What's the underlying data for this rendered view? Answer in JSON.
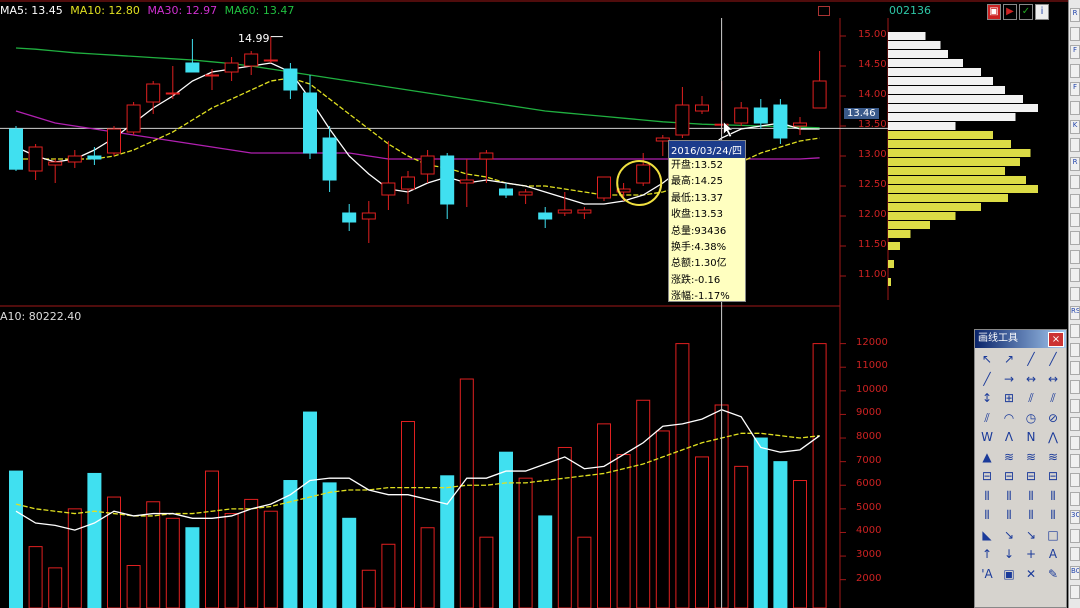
{
  "ma_legend": {
    "ma5": {
      "label": "MA5: 13.45",
      "color": "#ffffff"
    },
    "ma10": {
      "label": "MA10: 12.80",
      "color": "#e0e020"
    },
    "ma30": {
      "label": "MA30: 12.97",
      "color": "#c020c0"
    },
    "ma60": {
      "label": "MA60: 13.47",
      "color": "#20c040"
    }
  },
  "volume_legend": "A10: 80222.40",
  "stock_code": "002136",
  "current_price_tag": "13.46",
  "peak_label": "14.99",
  "price_axis_labels": [
    "15.00",
    "14.50",
    "14.00",
    "13.50",
    "13.00",
    "12.50",
    "12.00",
    "11.50",
    "11.00"
  ],
  "volume_axis_labels": [
    "12000",
    "11000",
    "10000",
    "9000",
    "8000",
    "7000",
    "6000",
    "5000",
    "4000",
    "3000",
    "2000"
  ],
  "tooltip": {
    "date": "2016/03/24/四",
    "rows": [
      "开盘:13.52",
      "最高:14.25",
      "最低:13.37",
      "收盘:13.53",
      "总量:93436",
      "换手:4.38%",
      "总额:1.30亿",
      "涨跌:-0.16",
      "涨幅:-1.17%"
    ]
  },
  "toolbox": {
    "title": "画线工具",
    "close": "×",
    "tools": [
      "↖",
      "↗",
      "╱",
      "╱",
      "╱",
      "→",
      "↔",
      "↔",
      "↕",
      "⊞",
      "⫽",
      "⫽",
      "⫽",
      "◠",
      "◷",
      "⊘",
      "W",
      "Λ",
      "Ν",
      "⋀",
      "▲",
      "≋",
      "≋",
      "≋",
      "⊟",
      "⊟",
      "⊟",
      "⊟",
      "⦀",
      "⦀",
      "⦀",
      "⦀",
      "⦀",
      "⦀",
      "⦀",
      "⦀",
      "◣",
      "↘",
      "↘",
      "□",
      "↑",
      "↓",
      "+",
      "A",
      "'A",
      "▣",
      "✕",
      "✎"
    ]
  },
  "right_strip_labels": [
    "R",
    "",
    "F",
    "",
    "F",
    "",
    "K",
    "",
    "R",
    "",
    "",
    "",
    "",
    "",
    "",
    "",
    "RS",
    "",
    "",
    "",
    "",
    "",
    "",
    "",
    "",
    "",
    "",
    "3C",
    "",
    "",
    "B0",
    ""
  ],
  "chart_data": {
    "type": "candlestick",
    "price_axis": {
      "ylim": [
        10.6,
        15.3
      ],
      "ticks": [
        15.0,
        14.5,
        14.0,
        13.5,
        13.0,
        12.5,
        12.0,
        11.5,
        11.0
      ]
    },
    "volume_axis": {
      "ylim": [
        800,
        13000
      ],
      "ticks": [
        12000,
        11000,
        10000,
        9000,
        8000,
        7000,
        6000,
        5000,
        4000,
        3000,
        2000
      ]
    },
    "up_color": "#e02020",
    "down_color": "#40e0f0",
    "candles": [
      {
        "o": 13.45,
        "h": 13.5,
        "l": 12.75,
        "c": 12.78
      },
      {
        "o": 12.75,
        "h": 13.2,
        "l": 12.6,
        "c": 13.15
      },
      {
        "o": 12.85,
        "h": 12.95,
        "l": 12.55,
        "c": 12.9
      },
      {
        "o": 12.9,
        "h": 13.1,
        "l": 12.8,
        "c": 13.0
      },
      {
        "o": 13.0,
        "h": 13.15,
        "l": 12.85,
        "c": 12.95
      },
      {
        "o": 13.05,
        "h": 13.5,
        "l": 13.0,
        "c": 13.45
      },
      {
        "o": 13.4,
        "h": 13.9,
        "l": 13.35,
        "c": 13.85
      },
      {
        "o": 13.9,
        "h": 14.25,
        "l": 13.7,
        "c": 14.2
      },
      {
        "o": 14.05,
        "h": 14.5,
        "l": 13.95,
        "c": 14.05
      },
      {
        "o": 14.55,
        "h": 14.95,
        "l": 14.4,
        "c": 14.4
      },
      {
        "o": 14.35,
        "h": 14.45,
        "l": 14.1,
        "c": 14.35
      },
      {
        "o": 14.4,
        "h": 14.65,
        "l": 14.25,
        "c": 14.55
      },
      {
        "o": 14.5,
        "h": 14.75,
        "l": 14.35,
        "c": 14.7
      },
      {
        "o": 14.6,
        "h": 14.99,
        "l": 14.55,
        "c": 14.6
      },
      {
        "o": 14.45,
        "h": 14.55,
        "l": 13.95,
        "c": 14.1
      },
      {
        "o": 14.05,
        "h": 14.35,
        "l": 12.95,
        "c": 13.05
      },
      {
        "o": 13.3,
        "h": 13.5,
        "l": 12.4,
        "c": 12.6
      },
      {
        "o": 12.05,
        "h": 12.2,
        "l": 11.75,
        "c": 11.9
      },
      {
        "o": 11.95,
        "h": 12.25,
        "l": 11.55,
        "c": 12.05
      },
      {
        "o": 12.35,
        "h": 13.25,
        "l": 12.1,
        "c": 12.55
      },
      {
        "o": 12.45,
        "h": 12.75,
        "l": 12.2,
        "c": 12.65
      },
      {
        "o": 12.7,
        "h": 13.1,
        "l": 12.55,
        "c": 13.0
      },
      {
        "o": 13.0,
        "h": 13.05,
        "l": 11.95,
        "c": 12.2
      },
      {
        "o": 12.55,
        "h": 12.95,
        "l": 12.15,
        "c": 12.6
      },
      {
        "o": 12.95,
        "h": 13.1,
        "l": 12.55,
        "c": 13.05
      },
      {
        "o": 12.45,
        "h": 12.55,
        "l": 12.3,
        "c": 12.35
      },
      {
        "o": 12.35,
        "h": 12.45,
        "l": 12.2,
        "c": 12.4
      },
      {
        "o": 12.05,
        "h": 12.15,
        "l": 11.8,
        "c": 11.95
      },
      {
        "o": 12.05,
        "h": 12.4,
        "l": 12.0,
        "c": 12.1
      },
      {
        "o": 12.05,
        "h": 12.15,
        "l": 11.95,
        "c": 12.1
      },
      {
        "o": 12.3,
        "h": 12.65,
        "l": 12.25,
        "c": 12.65
      },
      {
        "o": 12.4,
        "h": 12.55,
        "l": 12.25,
        "c": 12.45
      },
      {
        "o": 12.55,
        "h": 13.05,
        "l": 12.5,
        "c": 12.85
      },
      {
        "o": 13.25,
        "h": 13.35,
        "l": 13.0,
        "c": 13.3
      },
      {
        "o": 13.35,
        "h": 14.15,
        "l": 13.3,
        "c": 13.85
      },
      {
        "o": 13.75,
        "h": 14.0,
        "l": 13.7,
        "c": 13.85
      },
      {
        "o": 13.52,
        "h": 14.25,
        "l": 13.37,
        "c": 13.53
      },
      {
        "o": 13.55,
        "h": 13.9,
        "l": 13.5,
        "c": 13.8
      },
      {
        "o": 13.8,
        "h": 13.95,
        "l": 13.45,
        "c": 13.55
      },
      {
        "o": 13.85,
        "h": 13.95,
        "l": 13.2,
        "c": 13.3
      },
      {
        "o": 13.5,
        "h": 13.65,
        "l": 13.35,
        "c": 13.55
      },
      {
        "o": 13.8,
        "h": 14.75,
        "l": 13.85,
        "c": 14.25
      }
    ],
    "volumes": [
      6600,
      3400,
      2500,
      5000,
      6500,
      5500,
      2600,
      5300,
      4600,
      4200,
      6600,
      4800,
      5400,
      4900,
      6200,
      9100,
      6100,
      4600,
      2400,
      3500,
      8700,
      4200,
      6400,
      10500,
      3800,
      7400,
      6300,
      4700,
      7600,
      3800,
      8600,
      7300,
      9600,
      8300,
      12000,
      7200,
      9400,
      6800,
      8000,
      7000,
      6200,
      12000
    ],
    "ma5": [
      13.15,
      13.0,
      12.9,
      12.95,
      13.1,
      13.3,
      13.55,
      13.8,
      14.0,
      14.25,
      14.4,
      14.45,
      14.5,
      14.55,
      14.4,
      13.95,
      13.45,
      13.0,
      12.7,
      12.45,
      12.4,
      12.55,
      12.65,
      12.55,
      12.6,
      12.55,
      12.5,
      12.4,
      12.3,
      12.2,
      12.2,
      12.25,
      12.35,
      12.55,
      12.8,
      13.05,
      13.3,
      13.45,
      13.5,
      13.55,
      13.45,
      13.45
    ],
    "ma10": [
      12.95,
      12.95,
      12.95,
      12.95,
      12.95,
      13.0,
      13.1,
      13.25,
      13.4,
      13.6,
      13.8,
      13.95,
      14.1,
      14.25,
      14.3,
      14.2,
      13.95,
      13.7,
      13.45,
      13.2,
      13.0,
      12.85,
      12.8,
      12.7,
      12.65,
      12.55,
      12.5,
      12.5,
      12.45,
      12.4,
      12.35,
      12.35,
      12.35,
      12.4,
      12.5,
      12.65,
      12.8,
      12.9,
      13.05,
      13.15,
      13.25,
      13.3
    ],
    "ma30": [
      13.75,
      13.65,
      13.55,
      13.5,
      13.45,
      13.4,
      13.35,
      13.3,
      13.25,
      13.2,
      13.15,
      13.1,
      13.05,
      13.05,
      13.05,
      13.05,
      13.05,
      13.05,
      13.0,
      12.95,
      12.95,
      12.95,
      12.95,
      12.95,
      12.95,
      12.95,
      12.95,
      12.95,
      12.95,
      12.95,
      12.95,
      12.95,
      12.95,
      12.95,
      12.95,
      12.95,
      12.95,
      12.95,
      12.95,
      12.95,
      12.95,
      12.97
    ],
    "ma60": [
      14.8,
      14.78,
      14.75,
      14.72,
      14.7,
      14.68,
      14.66,
      14.64,
      14.62,
      14.6,
      14.57,
      14.54,
      14.5,
      14.45,
      14.4,
      14.35,
      14.3,
      14.25,
      14.2,
      14.15,
      14.1,
      14.05,
      14.0,
      13.95,
      13.9,
      13.85,
      13.8,
      13.75,
      13.72,
      13.69,
      13.66,
      13.63,
      13.6,
      13.57,
      13.55,
      13.53,
      13.52,
      13.51,
      13.5,
      13.49,
      13.48,
      13.47
    ],
    "vol_ma5": [
      4900,
      4400,
      4300,
      4100,
      4400,
      4900,
      4700,
      4800,
      4800,
      4600,
      4600,
      4700,
      5000,
      5200,
      5600,
      6200,
      6300,
      6300,
      5800,
      5600,
      5600,
      5400,
      5200,
      6300,
      6300,
      6600,
      6600,
      6900,
      7200,
      6700,
      6800,
      7300,
      7800,
      8500,
      8600,
      8800,
      9200,
      8900,
      7600,
      7400,
      7500,
      8100
    ],
    "vol_ma10": [
      5200,
      5000,
      4900,
      4800,
      4900,
      4800,
      4700,
      4700,
      4800,
      4800,
      4900,
      5000,
      5000,
      5100,
      5300,
      5500,
      5700,
      5800,
      5800,
      5900,
      5900,
      5900,
      5900,
      6000,
      6000,
      6100,
      6100,
      6200,
      6300,
      6400,
      6500,
      6700,
      6900,
      7200,
      7500,
      7800,
      8000,
      8200,
      8200,
      8100,
      8000,
      8100
    ],
    "volume_profile": [
      {
        "price": 15.0,
        "v": 0.25
      },
      {
        "price": 14.85,
        "v": 0.35
      },
      {
        "price": 14.7,
        "v": 0.4
      },
      {
        "price": 14.55,
        "v": 0.5
      },
      {
        "price": 14.4,
        "v": 0.62
      },
      {
        "price": 14.25,
        "v": 0.7
      },
      {
        "price": 14.1,
        "v": 0.78
      },
      {
        "price": 13.95,
        "v": 0.9
      },
      {
        "price": 13.8,
        "v": 1.0
      },
      {
        "price": 13.65,
        "v": 0.85
      },
      {
        "price": 13.5,
        "v": 0.45
      },
      {
        "price": 13.35,
        "v": 0.7
      },
      {
        "price": 13.2,
        "v": 0.82
      },
      {
        "price": 13.05,
        "v": 0.95
      },
      {
        "price": 12.9,
        "v": 0.88
      },
      {
        "price": 12.75,
        "v": 0.78
      },
      {
        "price": 12.6,
        "v": 0.92
      },
      {
        "price": 12.45,
        "v": 1.0
      },
      {
        "price": 12.3,
        "v": 0.8
      },
      {
        "price": 12.15,
        "v": 0.62
      },
      {
        "price": 12.0,
        "v": 0.45
      },
      {
        "price": 11.85,
        "v": 0.28
      },
      {
        "price": 11.7,
        "v": 0.15
      },
      {
        "price": 11.5,
        "v": 0.08
      },
      {
        "price": 11.2,
        "v": 0.04
      },
      {
        "price": 10.9,
        "v": 0.02
      }
    ],
    "current_price": 13.46,
    "highlight_index": 36,
    "circled_index": 32
  }
}
